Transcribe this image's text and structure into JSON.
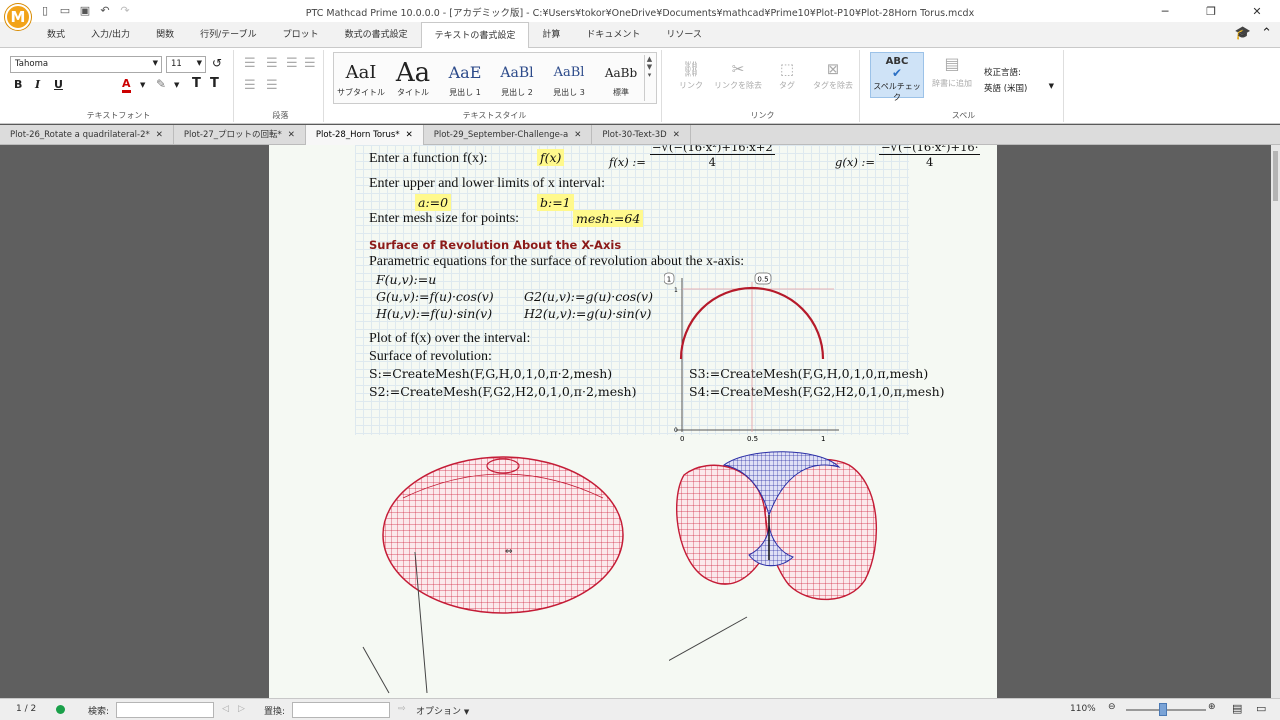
{
  "app": {
    "logo_letter": "M",
    "title": "PTC Mathcad Prime 10.0.0.0 - [アカデミック版] - C:¥Users¥tokor¥OneDrive¥Documents¥mathcad¥Prime10¥Plot-P10¥Plot-28Horn Torus.mcdx"
  },
  "menu": {
    "tabs": [
      "数式",
      "入力/出力",
      "関数",
      "行列/テーブル",
      "プロット",
      "数式の書式設定",
      "テキストの書式設定",
      "計算",
      "ドキュメント",
      "リソース"
    ],
    "active_tab": "テキストの書式設定"
  },
  "ribbon": {
    "font_name": "Tahoma",
    "font_size": "11",
    "bold": "B",
    "italic": "I",
    "underline": "U",
    "font_color": "A",
    "group_text_font": "テキストフォント",
    "group_paragraph": "段落",
    "styles": [
      {
        "sample": "AaI",
        "label": "サブタイトル"
      },
      {
        "sample": "Aa",
        "label": "タイトル"
      },
      {
        "sample": "AaE",
        "label": "見出し 1"
      },
      {
        "sample": "AaBl",
        "label": "見出し 2"
      },
      {
        "sample": "AaBl",
        "label": "見出し 3"
      },
      {
        "sample": "AaBb",
        "label": "標準"
      }
    ],
    "group_text_style": "テキストスタイル",
    "link_buttons": [
      {
        "label": "リンク",
        "icon": "link-icon"
      },
      {
        "label": "リンクを除去",
        "icon": "unlink-icon"
      },
      {
        "label": "タグ",
        "icon": "tag-icon"
      },
      {
        "label": "タグを除去",
        "icon": "remove-tag-icon"
      }
    ],
    "group_link": "リンク",
    "spell_check_icon": "ABC",
    "spell_check": "スペルチェック",
    "add_dictionary": "辞書に追加",
    "proof_language_label": "校正言語:",
    "proof_language": "英語 (米国)",
    "group_spell": "スペル"
  },
  "doc_tabs": [
    {
      "label": "Plot-26_Rotate a quadrilateral-2",
      "modified": "*",
      "active": false
    },
    {
      "label": "Plot-27_プロットの回転",
      "modified": "*",
      "active": false
    },
    {
      "label": "Plot-28_Horn Torus",
      "modified": "*",
      "active": true
    },
    {
      "label": "Plot-29_September-Challenge-a",
      "modified": "",
      "active": false
    },
    {
      "label": "Plot-30-Text-3D",
      "modified": "",
      "active": false
    }
  ],
  "worksheet": {
    "line_function": "Enter a function f(x):",
    "fx_placeholder": "f(x)",
    "fx_def_num": "−√(−(16·x²)+16·x+2",
    "fx_def_den": "4",
    "gx_def_num": "−√(−(16·x²)+16·",
    "gx_def_den": "4",
    "line_limits": "Enter upper and lower limits of x interval:",
    "a_def": "a:=0",
    "b_def": "b:=1",
    "line_mesh": "Enter mesh size for points:",
    "mesh_def": "mesh:=64",
    "heading": "Surface of Revolution About the X-Axis",
    "line_param": "Parametric equations for the surface of revolution about the x-axis:",
    "F_def": "F(u,v):=u",
    "G_def": "G(u,v):=f(u)·cos(v)",
    "G2_def": "G2(u,v):=g(u)·cos(v)",
    "H_def": "H(u,v):=f(u)·sin(v)",
    "H2_def": "H2(u,v):=g(u)·sin(v)",
    "line_plot": "Plot of f(x) over the interval:",
    "line_surface": "Surface of revolution:",
    "S_def": "S:=CreateMesh(F,G,H,0,1,0,π·2,mesh)",
    "S2_def": "S2:=CreateMesh(F,G2,H2,0,1,0,π·2,mesh)",
    "S3_def": "S3:=CreateMesh(F,G,H,0,1,0,π,mesh)",
    "S4_def": "S4:=CreateMesh(F,G2,H2,0,1,0,π,mesh)"
  },
  "plot2d": {
    "y_marker": "1",
    "x_marker": "0.5",
    "y_top": "1",
    "y_bottom": "0",
    "x_left": "0",
    "x_mid": "0.5",
    "x_right": "1",
    "curve_color": "#b51a2a"
  },
  "surface_colors": {
    "red": "#d0213c",
    "blue": "#2b2fa6"
  },
  "statusbar": {
    "page": "1 / 2",
    "search_label": "検索:",
    "replace_label": "置換:",
    "options": "オプション",
    "zoom": "110%"
  }
}
